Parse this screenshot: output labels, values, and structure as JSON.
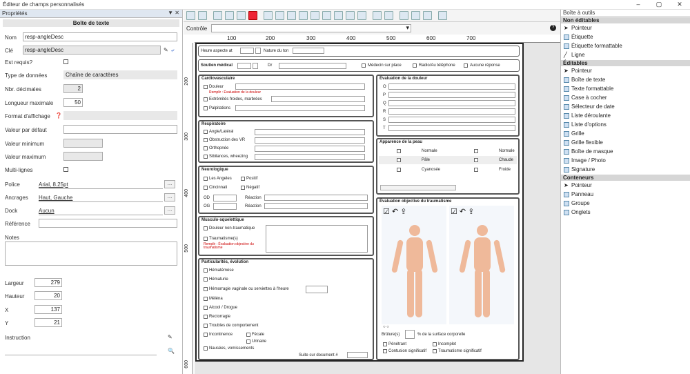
{
  "window": {
    "title": "Éditeur de champs personnalisés",
    "min": "–",
    "max": "▢",
    "close": "✕"
  },
  "props": {
    "header": "Propriétés",
    "pin": "▼ ✕",
    "title": "Boîte de texte",
    "nom_label": "Nom",
    "nom": "resp-angleDesc",
    "cle_label": "Clé",
    "cle": "resp-angleDesc",
    "requis": "Est requis?",
    "type_label": "Type de données",
    "type": "Chaîne de caractères",
    "dec_label": "Nbr. décimales",
    "dec": "2",
    "len_label": "Longueur maximale",
    "len": "50",
    "fmt": "Format d'affichage",
    "def": "Valeur par défaut",
    "min": "Valeur minimum",
    "max": "Valeur maximum",
    "multi": "Multi-lignes",
    "police_label": "Police",
    "police": "Arial, 8.25pt",
    "anc_label": "Ancrages",
    "anc": "Haut, Gauche",
    "dock_label": "Dock",
    "dock": "Aucun",
    "ref": "Référence",
    "notes": "Notes",
    "larg_label": "Largeur",
    "larg": "279",
    "haut_label": "Hauteur",
    "haut": "20",
    "x_label": "X",
    "x": "137",
    "y_label": "Y",
    "y": "21",
    "instr": "Instruction",
    "dots": "…"
  },
  "ctrl": {
    "label": "Contrôle",
    "help": "?"
  },
  "ruler": {
    "h": [
      "100",
      "200",
      "300",
      "400",
      "500",
      "600",
      "700"
    ],
    "v": [
      "200",
      "300",
      "400",
      "500",
      "600"
    ]
  },
  "form": {
    "r1a": "Heure aspecte at",
    "r1b": "Nature du ton",
    "r2a": "Soutien médical",
    "r2b": "Dr",
    "r2c": "Médecin sur place",
    "r2d": "Radio/Au téléphone",
    "r2e": "Aucune réponse",
    "cardio": "Cardiovasculaire",
    "c1": "Douleur",
    "c1r": "Remplir : Évaluation de la douleur",
    "c2": "Extrémités froides, marbrées",
    "c3": "Palpitations",
    "douleur": "Évaluation de la douleur",
    "dl": [
      "O",
      "P",
      "Q",
      "R",
      "S",
      "T"
    ],
    "resp": "Respiratoire",
    "rs1": "Angle/Latéral",
    "rs2": "Obstruction des VR",
    "rs3": "Orthopnée",
    "rs4": "Sibilances, wheezing",
    "peau": "Apparence de la peau",
    "p1": "Normale",
    "p2": "Normale",
    "p3": "Pâle",
    "p4": "Chaude",
    "p5": "Cyanosée",
    "p6": "Froide",
    "neuro": "Neurologique",
    "n1": "Les Angeles",
    "n2": "Positif",
    "n3": "Cincinnati",
    "n4": "Négatif",
    "n5": "OD",
    "n6": "OG",
    "n7": "Réaction",
    "n8": "Réaction",
    "musc": "Musculo-squelettique",
    "m1": "Douleur non-traumatique",
    "m2": "Traumatisme(s)",
    "m3": "Remplir : Évaluation objective du traumatisme",
    "trauma": "Évaluation objective du traumatisme",
    "t1": "Brûlure(s)",
    "t2": "% de la surface corporelle",
    "t3": "Pénétrant",
    "t4": "Incomplet",
    "t5": "Contusion significatif",
    "t6": "Traumatisme significatif",
    "part": "Particularités, évolution",
    "pa": [
      "Hématémèse",
      "Hématurie",
      "Hémorragie vaginale ou serviettes à l'heure",
      "Méléna",
      "Alcool / Drogue",
      "Rectorragie",
      "Troubles de comportement",
      "Incontinence",
      "Nausées, vomissements"
    ],
    "pf": "Fécale",
    "pu": "Urinaire",
    "suite": "Suite sur document #"
  },
  "tools": {
    "header": "Boîte à outils",
    "cat1": "Non éditables",
    "i1": [
      "Pointeur",
      "Étiquette",
      "Étiquette formattable",
      "Ligne"
    ],
    "cat2": "Éditables",
    "i2": [
      "Pointeur",
      "Boîte de texte",
      "Texte formattable",
      "Case à cocher",
      "Sélecteur de date",
      "Liste déroulante",
      "Liste d'options",
      "Grille",
      "Grille flexible",
      "Boîte de masque",
      "Image / Photo",
      "Signature"
    ],
    "cat3": "Conteneurs",
    "i3": [
      "Pointeur",
      "Panneau",
      "Groupe",
      "Onglets"
    ]
  }
}
